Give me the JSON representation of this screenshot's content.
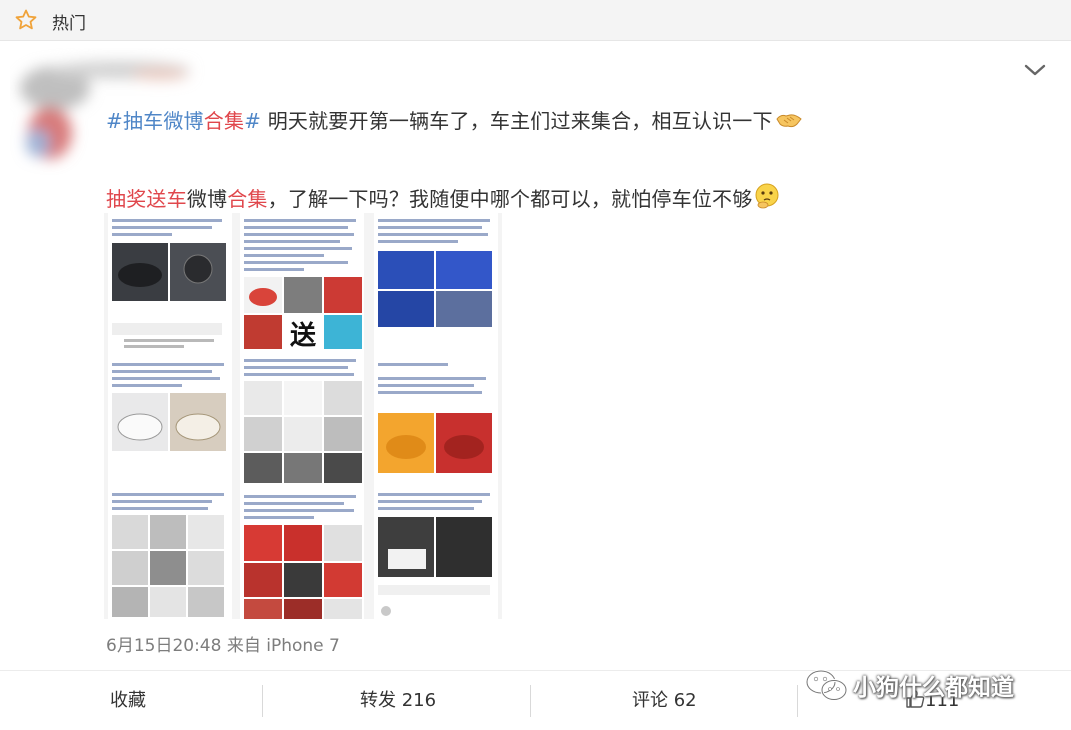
{
  "header": {
    "title": "热门",
    "star_icon": "star-icon"
  },
  "post": {
    "line1": {
      "topic": "#抽车微博",
      "topic_highlight": "合集",
      "topic_end": "#",
      "text": " 明天就要开第一辆车了，车主们过来集合，相互认识一下",
      "emoji": "handshake-emoji"
    },
    "line2": {
      "highlight1": "抽奖送车",
      "text1": "微博",
      "highlight2": "合集",
      "text2": "，了解一下吗？我随便中哪个都可以，就怕停车位不够",
      "emoji": "thinking-emoji"
    },
    "image_text_song": "送",
    "meta": "6月15日20:48 来自 iPhone 7"
  },
  "actions": {
    "favorite": "收藏",
    "repost": "转发 216",
    "comment": "评论 62",
    "like": "111"
  },
  "watermark": "小狗什么都知道",
  "colors": {
    "topic_blue": "#4f86c7",
    "highlight_red": "#e0474c",
    "meta_gray": "#7d7d7d"
  }
}
